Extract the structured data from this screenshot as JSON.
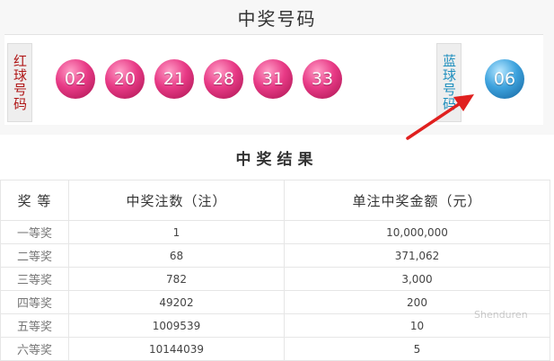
{
  "header": {
    "title": "中奖号码"
  },
  "red_label": "红球号码",
  "blue_label": "蓝球号码",
  "red_balls": [
    "02",
    "20",
    "21",
    "28",
    "31",
    "33"
  ],
  "blue_balls": [
    "06"
  ],
  "colors": {
    "red_ball": "#e83a86",
    "blue_ball": "#3ea3de",
    "arrow": "#e0201f"
  },
  "results": {
    "title": "中奖结果",
    "columns": [
      "奖 等",
      "中奖注数（注）",
      "单注中奖金额（元）"
    ],
    "rows": [
      {
        "level": "一等奖",
        "count": "1",
        "amount": "10,000,000"
      },
      {
        "level": "二等奖",
        "count": "68",
        "amount": "371,062"
      },
      {
        "level": "三等奖",
        "count": "782",
        "amount": "3,000"
      },
      {
        "level": "四等奖",
        "count": "49202",
        "amount": "200"
      },
      {
        "level": "五等奖",
        "count": "1009539",
        "amount": "10"
      },
      {
        "level": "六等奖",
        "count": "10144039",
        "amount": "5"
      }
    ]
  },
  "watermark": "Shenduren"
}
